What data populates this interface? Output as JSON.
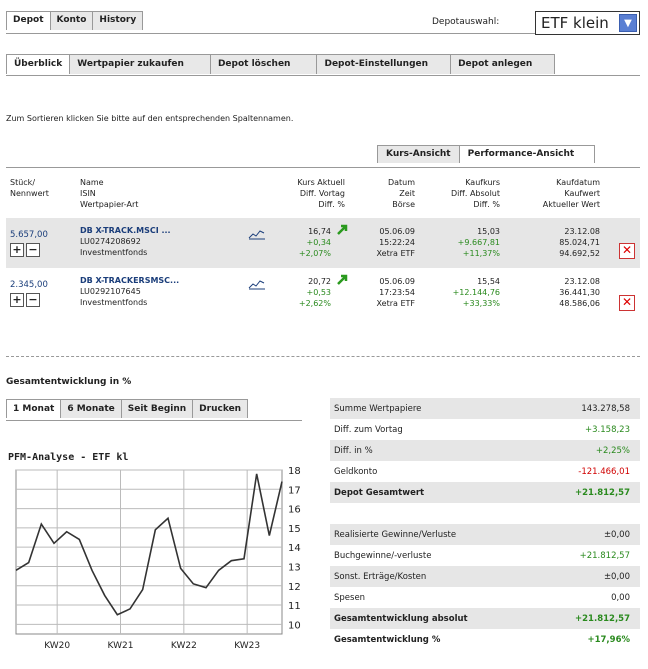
{
  "top_tabs": [
    "Depot",
    "Konto",
    "History"
  ],
  "depot_label": "Depotauswahl:",
  "depot_select": "ETF klein",
  "sub_tabs": [
    "Überblick",
    "Wertpapier zukaufen",
    "Depot löschen",
    "Depot-Einstellungen",
    "Depot anlegen"
  ],
  "hint": "Zum Sortieren klicken Sie bitte auf den entsprechenden Spaltennamen.",
  "view_tabs": [
    "Kurs-Ansicht",
    "Performance-Ansicht"
  ],
  "columns": {
    "stueck": [
      "Stück/",
      "Nennwert"
    ],
    "name": [
      "Name",
      "ISIN",
      "Wertpapier-Art"
    ],
    "kurs": [
      "Kurs Aktuell",
      "Diff. Vortag",
      "Diff. %"
    ],
    "datum": [
      "Datum",
      "Zeit",
      "Börse"
    ],
    "kaufkurs": [
      "Kaufkurs",
      "Diff. Absolut",
      "Diff. %"
    ],
    "kaufdatum": [
      "Kaufdatum",
      "Kaufwert",
      "Aktueller Wert"
    ]
  },
  "rows": [
    {
      "stueck": "5.657,00",
      "name": "DB X-TRACK.MSCI ...",
      "isin": "LU0274208692",
      "art": "Investmentfonds",
      "kurs": "16,74",
      "diff_vortag": "+0,34",
      "diff_pct": "+2,07%",
      "datum": "05.06.09",
      "zeit": "15:22:24",
      "boerse": "Xetra ETF",
      "kaufkurs": "15,03",
      "diff_abs": "+9.667,81",
      "diff_abs_pct": "+11,37%",
      "kaufdatum": "23.12.08",
      "kaufwert": "85.024,71",
      "aktuell": "94.692,52"
    },
    {
      "stueck": "2.345,00",
      "name": "DB X-TRACKERSMSC...",
      "isin": "LU0292107645",
      "art": "Investmentfonds",
      "kurs": "20,72",
      "diff_vortag": "+0,53",
      "diff_pct": "+2,62%",
      "datum": "05.06.09",
      "zeit": "17:23:54",
      "boerse": "Xetra ETF",
      "kaufkurs": "15,54",
      "diff_abs": "+12.144,76",
      "diff_abs_pct": "+33,33%",
      "kaufdatum": "23.12.08",
      "kaufwert": "36.441,30",
      "aktuell": "48.586,06"
    }
  ],
  "gesamt_title": "Gesamtentwicklung in %",
  "bottom_tabs": [
    "1 Monat",
    "6 Monate",
    "Seit Beginn",
    "Drucken"
  ],
  "chart_title": "PFM-Analyse - ETF kl",
  "chart_data": {
    "type": "line",
    "title": "PFM-Analyse - ETF kl",
    "x_ticks": [
      "KW20",
      "KW21",
      "KW22",
      "KW23"
    ],
    "ylim": [
      9.5,
      18
    ],
    "y_ticks": [
      10,
      11,
      12,
      13,
      14,
      15,
      16,
      17,
      18
    ],
    "grid": true,
    "values": [
      12.8,
      13.2,
      15.2,
      14.2,
      14.8,
      14.4,
      12.8,
      11.5,
      10.5,
      10.8,
      11.8,
      14.9,
      15.5,
      12.9,
      12.1,
      11.9,
      12.8,
      13.3,
      13.4,
      17.8,
      14.6,
      17.4
    ]
  },
  "summary": [
    {
      "label": "Summe Wertpapiere",
      "value": "143.278,58",
      "bold": false,
      "bg": true,
      "color": "#222"
    },
    {
      "label": "Diff. zum Vortag",
      "value": "+3.158,23",
      "bold": false,
      "bg": false,
      "color": "#2a8a1e"
    },
    {
      "label": "Diff. in %",
      "value": "+2,25%",
      "bold": false,
      "bg": true,
      "color": "#2a8a1e"
    },
    {
      "label": "Geldkonto",
      "value": "-121.466,01",
      "bold": false,
      "bg": false,
      "color": "#d00000"
    },
    {
      "label": "Depot Gesamtwert",
      "value": "+21.812,57",
      "bold": true,
      "bg": true,
      "color": "#2a8a1e"
    }
  ],
  "summary2": [
    {
      "label": "Realisierte Gewinne/Verluste",
      "value": "±0,00",
      "bold": false,
      "bg": true,
      "color": "#222"
    },
    {
      "label": "Buchgewinne/-verluste",
      "value": "+21.812,57",
      "bold": false,
      "bg": false,
      "color": "#2a8a1e"
    },
    {
      "label": "Sonst. Erträge/Kosten",
      "value": "±0,00",
      "bold": false,
      "bg": true,
      "color": "#222"
    },
    {
      "label": "Spesen",
      "value": "0,00",
      "bold": false,
      "bg": false,
      "color": "#222"
    },
    {
      "label": "Gesamtentwicklung absolut",
      "value": "+21.812,57",
      "bold": true,
      "bg": true,
      "color": "#2a8a1e"
    },
    {
      "label": "Gesamtentwicklung %",
      "value": "+17,96%",
      "bold": true,
      "bg": false,
      "color": "#2a8a1e"
    }
  ]
}
